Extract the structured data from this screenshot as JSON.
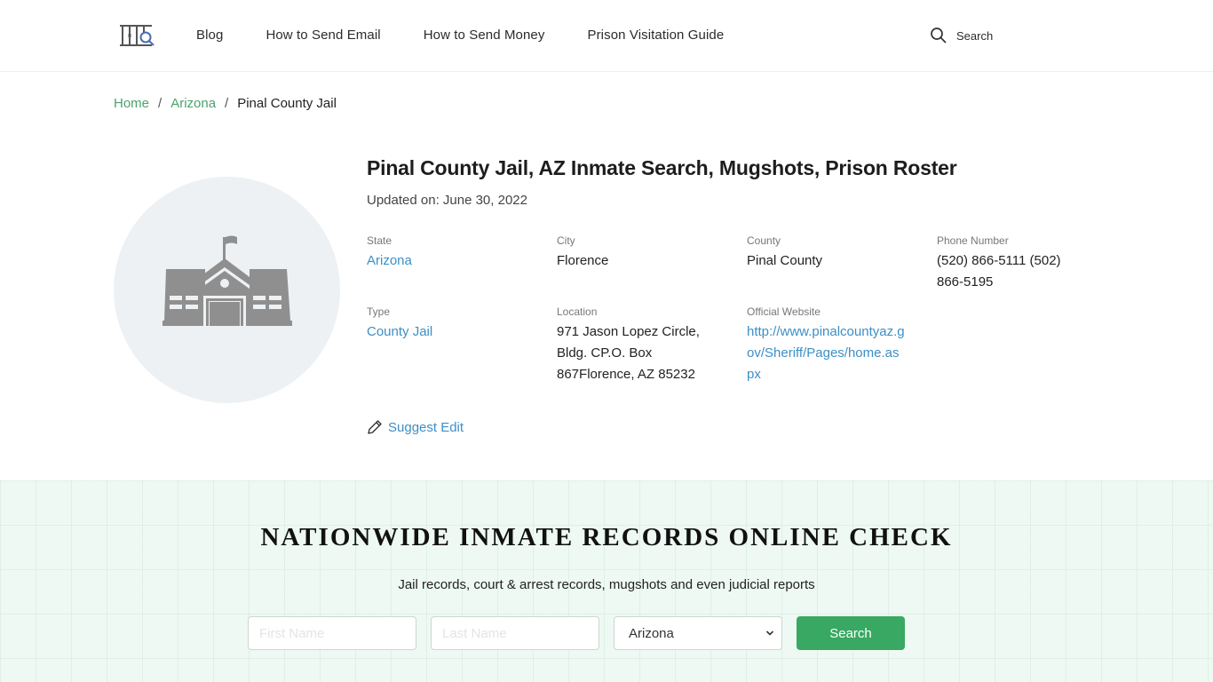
{
  "header": {
    "logo_alt": "prison-search-logo",
    "nav": [
      {
        "label": "Blog"
      },
      {
        "label": "How to Send Email"
      },
      {
        "label": "How to Send Money"
      },
      {
        "label": "Prison Visitation Guide"
      }
    ],
    "search_label": "Search"
  },
  "breadcrumb": {
    "items": [
      {
        "label": "Home"
      },
      {
        "label": "Arizona"
      }
    ],
    "separator": "/",
    "current": "Pinal County Jail"
  },
  "facility": {
    "title": "Pinal County Jail, AZ Inmate Search, Mugshots, Prison Roster",
    "updated": "Updated on: June 30, 2022",
    "fields": {
      "state": {
        "label": "State",
        "value": "Arizona"
      },
      "city": {
        "label": "City",
        "value": "Florence"
      },
      "county": {
        "label": "County",
        "value": "Pinal County"
      },
      "phone": {
        "label": "Phone Number",
        "value": "(520) 866-5111 (502) 866-5195"
      },
      "type": {
        "label": "Type",
        "value": "County Jail"
      },
      "location": {
        "label": "Location",
        "value": "971 Jason Lopez Circle, Bldg. CP.O. Box 867Florence, AZ 85232"
      },
      "website": {
        "label": "Official Website",
        "value": "http://www.pinalcountyaz.gov/Sheriff/Pages/home.aspx"
      }
    },
    "suggest_edit": "Suggest Edit"
  },
  "promo": {
    "heading": "NATIONWIDE INMATE RECORDS ONLINE CHECK",
    "subtitle": "Jail records, court & arrest records, mugshots and even judicial reports",
    "first_name_placeholder": "First Name",
    "last_name_placeholder": "Last Name",
    "state_selected": "Arizona",
    "search_button": "Search"
  },
  "colors": {
    "link_green": "#4aa36c",
    "link_blue": "#3d8fc6",
    "button_green": "#38a862",
    "promo_bg": "#eef9f3",
    "avatar_bg": "#edf1f4",
    "icon_gray": "#8f8f8f"
  }
}
